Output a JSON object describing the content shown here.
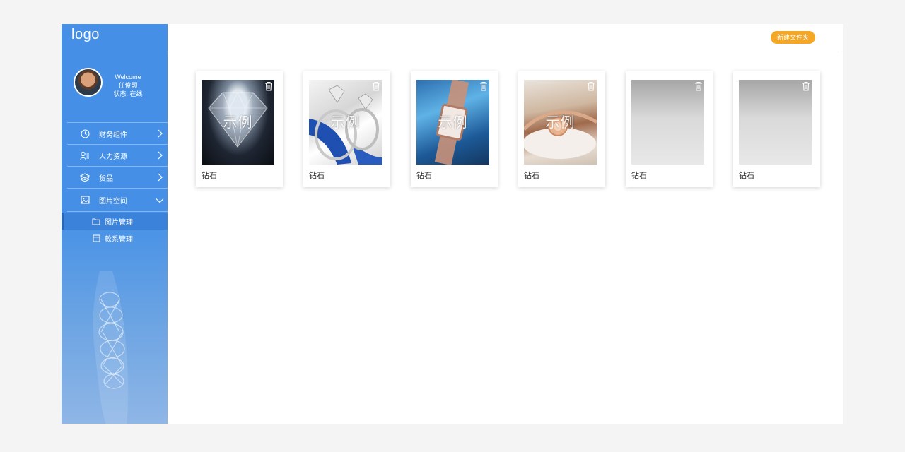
{
  "sidebar": {
    "logo": "logo",
    "user": {
      "greeting": "Welcome",
      "name": "任俊颢",
      "status": "状态: 在线"
    },
    "menu": [
      {
        "label": "财务组件",
        "icon": "clock-icon"
      },
      {
        "label": "人力资源",
        "icon": "user-list-icon"
      },
      {
        "label": "货品",
        "icon": "layers-icon"
      },
      {
        "label": "图片空间",
        "icon": "image-icon"
      }
    ],
    "submenu": [
      {
        "label": "图片管理",
        "icon": "folder-icon",
        "active": true
      },
      {
        "label": "款系管理",
        "icon": "window-icon",
        "active": false
      }
    ]
  },
  "toolbar": {
    "new_folder_label": "新建文件夹"
  },
  "gallery": {
    "items": [
      {
        "caption": "钻石",
        "watermark": "示例"
      },
      {
        "caption": "钻石",
        "watermark": "示例"
      },
      {
        "caption": "钻石",
        "watermark": "示例"
      },
      {
        "caption": "钻石",
        "watermark": "示例"
      },
      {
        "caption": "钻石",
        "watermark": ""
      },
      {
        "caption": "钻石",
        "watermark": ""
      }
    ]
  },
  "colors": {
    "sidebar": "#4590e6",
    "accent_button": "#f5a623",
    "active_submenu": "#3b82da"
  }
}
